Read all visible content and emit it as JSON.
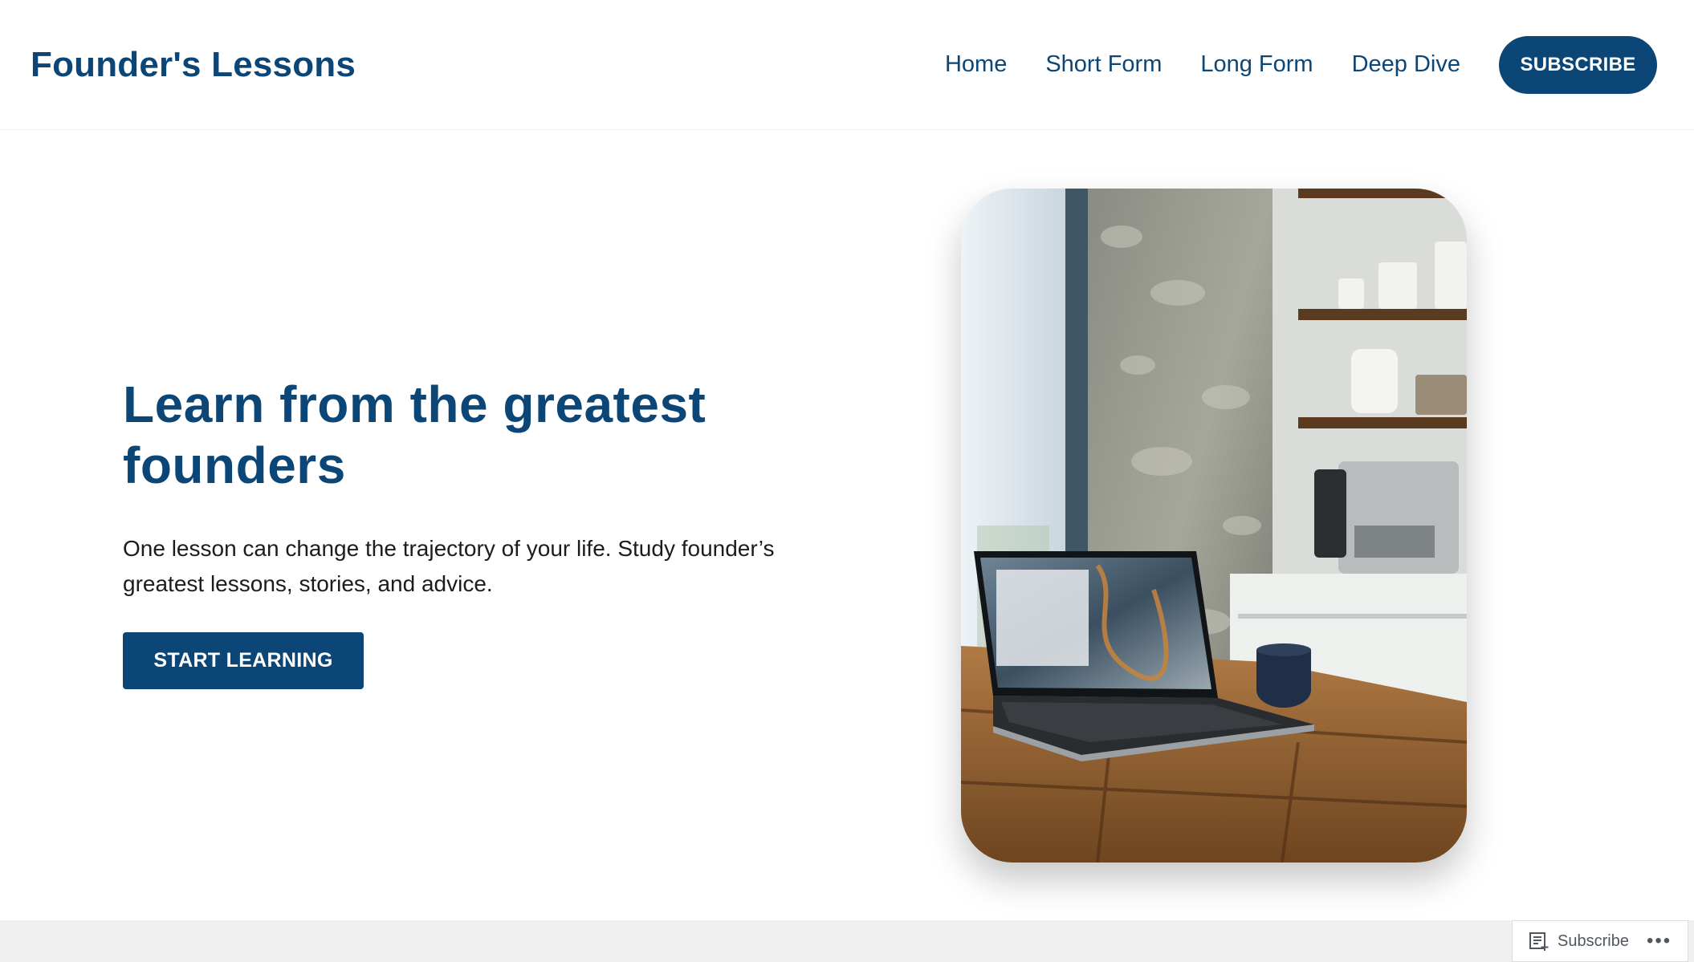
{
  "header": {
    "site_title": "Founder's Lessons",
    "nav": [
      "Home",
      "Short Form",
      "Long Form",
      "Deep Dive"
    ],
    "subscribe_label": "SUBSCRIBE"
  },
  "hero": {
    "heading": "Learn from the greatest founders",
    "subheading": "One lesson can change the trajectory of your life. Study founder’s greatest lessons, stories, and advice.",
    "cta_label": "START LEARNING"
  },
  "floating_bar": {
    "subscribe_label": "Subscribe",
    "more_label": "•••"
  },
  "colors": {
    "brand": "#0b4677",
    "text": "#1c1c1c",
    "footer_bg": "#f0f0f1"
  }
}
